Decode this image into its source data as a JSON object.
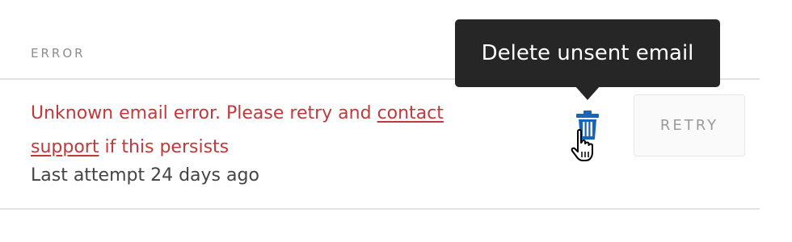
{
  "header": {
    "error_column_label": "ERROR"
  },
  "row": {
    "error_text_before_link": "Unknown email error. Please retry and ",
    "error_link_text": "contact support",
    "error_text_after_link": " if this persists",
    "last_attempt": "Last attempt 24 days ago",
    "delete_icon": "trash-icon",
    "retry_label": "RETRY"
  },
  "tooltip": {
    "text": "Delete unsent email"
  },
  "colors": {
    "error_red": "#c0393b",
    "icon_blue": "#1565b8",
    "tooltip_bg": "#262626"
  }
}
